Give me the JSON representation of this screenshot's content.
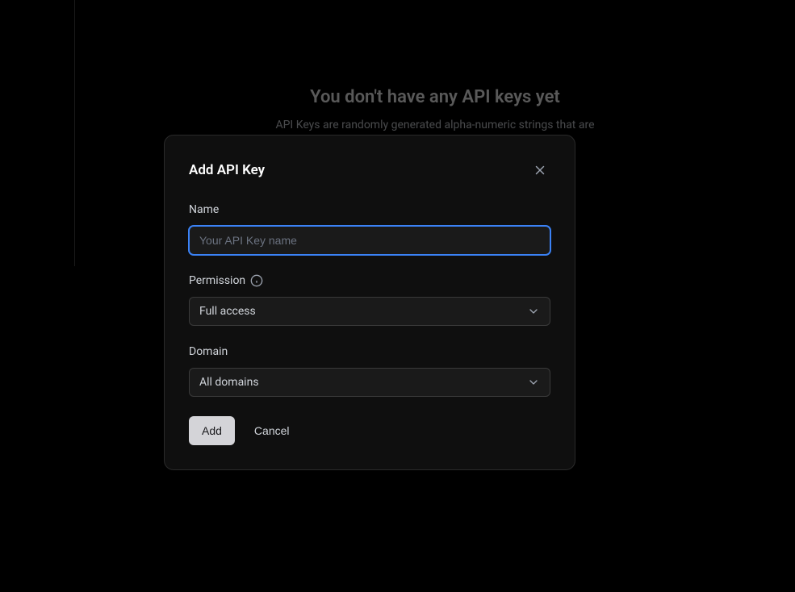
{
  "background": {
    "empty_title": "You don't have any API keys yet",
    "empty_description": "API Keys are randomly generated alpha-numeric strings that are"
  },
  "modal": {
    "title": "Add API Key",
    "fields": {
      "name": {
        "label": "Name",
        "placeholder": "Your API Key name",
        "value": ""
      },
      "permission": {
        "label": "Permission",
        "selected": "Full access"
      },
      "domain": {
        "label": "Domain",
        "selected": "All domains"
      }
    },
    "buttons": {
      "add": "Add",
      "cancel": "Cancel"
    }
  }
}
